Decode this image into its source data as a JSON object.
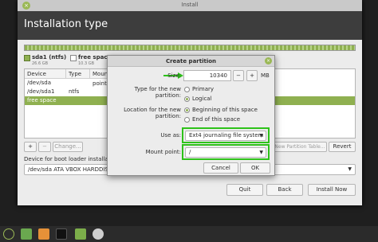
{
  "window": {
    "title": "Install",
    "close_glyph": "×"
  },
  "header": {
    "title": "Installation type"
  },
  "legend": [
    {
      "name": "sda1 (ntfs)",
      "size": "26.6 GB",
      "color": "#8fb050"
    },
    {
      "name": "free space",
      "size": "10.3 GB",
      "color": "#ffffff"
    }
  ],
  "table": {
    "headers": [
      "Device",
      "Type",
      "Mount point"
    ],
    "rows": [
      {
        "device": "/dev/sda",
        "type": ""
      },
      {
        "device": "/dev/sda1",
        "type": "ntfs"
      },
      {
        "device": "free space",
        "type": ""
      }
    ]
  },
  "table_buttons": {
    "add": "+",
    "remove": "−",
    "change": "Change...",
    "new_table": "New Partition Table...",
    "revert": "Revert"
  },
  "boot": {
    "label": "Device for boot loader installation:",
    "value": "/dev/sda    ATA VBOX HARDDISK"
  },
  "actions": {
    "quit": "Quit",
    "back": "Back",
    "install": "Install Now"
  },
  "dialog": {
    "title": "Create partition",
    "size_label": "Size:",
    "size_value": "10340",
    "size_unit": "MB",
    "minus": "−",
    "plus": "+",
    "type_label": "Type for the new partition:",
    "type_options": [
      "Primary",
      "Logical"
    ],
    "location_label": "Location for the new partition:",
    "location_options": [
      "Beginning of this space",
      "End of this space"
    ],
    "use_as_label": "Use as:",
    "use_as_value": "Ext4 journaling file system",
    "mount_label": "Mount point:",
    "mount_value": "/",
    "cancel": "Cancel",
    "ok": "OK"
  },
  "colors": {
    "accent": "#8fb050",
    "highlight": "#2ec21a",
    "header_bg": "#3d3d3d"
  },
  "taskbar": {
    "icons": [
      "mint-menu-icon",
      "files-icon",
      "installer-icon",
      "terminal-icon",
      "folder-icon",
      "disc-icon"
    ]
  }
}
